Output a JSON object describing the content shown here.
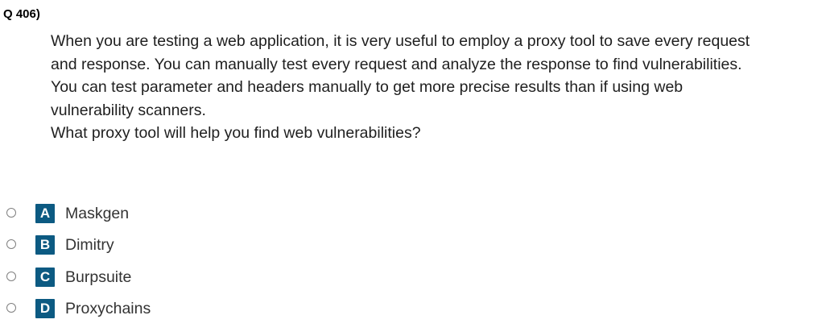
{
  "question": {
    "number": "Q 406)",
    "stem": [
      "When you are testing a web application, it is very useful to employ a proxy tool to save every request",
      "and response. You can manually test every request and analyze the response to find vulnerabilities.",
      "You can test parameter and headers manually to get more precise results than if using web",
      "vulnerability scanners.",
      "What proxy tool will help you find web vulnerabilities?"
    ]
  },
  "options": [
    {
      "letter": "A",
      "text": "Maskgen",
      "selected": false
    },
    {
      "letter": "B",
      "text": "Dimitry",
      "selected": false
    },
    {
      "letter": "C",
      "text": "Burpsuite",
      "selected": false
    },
    {
      "letter": "D",
      "text": "Proxychains",
      "selected": false
    }
  ],
  "colors": {
    "letter_badge_bg": "#0c5a82",
    "letter_badge_text": "#ffffff",
    "radio_border": "#808080"
  }
}
